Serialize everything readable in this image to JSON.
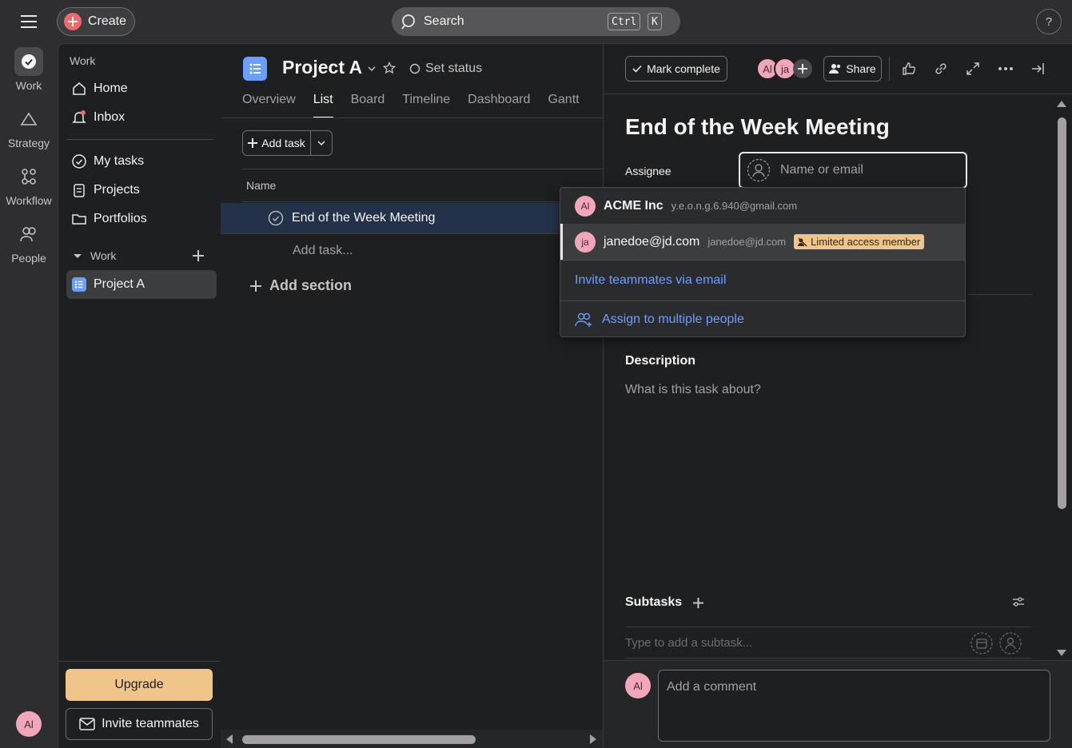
{
  "topbar": {
    "create_label": "Create",
    "search_label": "Search",
    "kbd_ctrl": "Ctrl",
    "kbd_k": "K",
    "help_label": "?"
  },
  "rail": {
    "items": [
      {
        "label": "Work",
        "icon": "check-circle-icon"
      },
      {
        "label": "Strategy",
        "icon": "triangle-icon"
      },
      {
        "label": "Workflow",
        "icon": "workflow-icon"
      },
      {
        "label": "People",
        "icon": "people-icon"
      }
    ],
    "user_initials": "Al"
  },
  "sidebar": {
    "section_title": "Work",
    "nav": [
      {
        "label": "Home",
        "icon": "home-icon"
      },
      {
        "label": "Inbox",
        "icon": "bell-icon"
      }
    ],
    "nav2": [
      {
        "label": "My tasks",
        "icon": "check-circle-icon"
      },
      {
        "label": "Projects",
        "icon": "clipboard-icon"
      },
      {
        "label": "Portfolios",
        "icon": "folder-icon"
      }
    ],
    "team_section": "Work",
    "project": "Project A",
    "upgrade_label": "Upgrade",
    "invite_label": "Invite teammates"
  },
  "main": {
    "project_title": "Project A",
    "set_status": "Set status",
    "tabs": [
      "Overview",
      "List",
      "Board",
      "Timeline",
      "Dashboard",
      "Gantt"
    ],
    "active_tab": "List",
    "add_task": "Add task",
    "column_name": "Name",
    "task_name": "End of the Week Meeting",
    "add_task_placeholder": "Add task...",
    "add_section": "Add section"
  },
  "detail": {
    "mark_complete": "Mark complete",
    "collaborators": [
      "Al",
      "ja"
    ],
    "share": "Share",
    "title": "End of the Week Meeting",
    "assignee_label": "Assignee",
    "assignee_placeholder": "Name or email",
    "description_label": "Description",
    "description_placeholder": "What is this task about?",
    "subtasks_label": "Subtasks",
    "subtask_placeholder": "Type to add a subtask...",
    "comment_placeholder": "Add a comment",
    "comment_avatar": "Al"
  },
  "dropdown": {
    "people": [
      {
        "initials": "Al",
        "name": "ACME Inc",
        "email": "y.e.o.n.g.6.940@gmail.com",
        "badge": ""
      },
      {
        "initials": "ja",
        "name": "janedoe@jd.com",
        "email": "janedoe@jd.com",
        "badge": "Limited access member"
      }
    ],
    "invite_link": "Invite teammates via email",
    "assign_multiple": "Assign to multiple people"
  },
  "colors": {
    "accent_red": "#f06a6a",
    "project_blue": "#6a9eff",
    "upgrade_gold": "#f0c58a",
    "avatar_pink": "#f1a7b9",
    "link_blue": "#6a9eff"
  }
}
